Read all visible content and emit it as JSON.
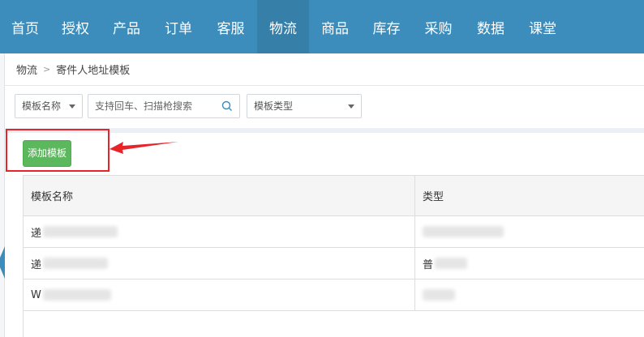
{
  "nav": {
    "items": [
      {
        "label": "首页",
        "active": false
      },
      {
        "label": "授权",
        "active": false
      },
      {
        "label": "产品",
        "active": false
      },
      {
        "label": "订单",
        "active": false
      },
      {
        "label": "客服",
        "active": false
      },
      {
        "label": "物流",
        "active": true
      },
      {
        "label": "商品",
        "active": false
      },
      {
        "label": "库存",
        "active": false
      },
      {
        "label": "采购",
        "active": false
      },
      {
        "label": "数据",
        "active": false
      },
      {
        "label": "课堂",
        "active": false
      }
    ],
    "bg_color": "#3c8dbc",
    "active_color": "#367fa9"
  },
  "breadcrumb": {
    "parent": "物流",
    "current": "寄件人地址模板"
  },
  "filters": {
    "template_name_select": "模板名称",
    "search_placeholder": "支持回车、扫描枪搜索",
    "template_type_select": "模板类型"
  },
  "toolbar": {
    "add_button_label": "添加模板",
    "add_button_color": "#5cb85c",
    "highlight_color": "#e6242a"
  },
  "table": {
    "headers": [
      "模板名称",
      "类型"
    ],
    "rows": [
      {
        "name": "递",
        "type": ""
      },
      {
        "name": "递",
        "type": "普"
      },
      {
        "name": "W",
        "type": ""
      }
    ]
  }
}
